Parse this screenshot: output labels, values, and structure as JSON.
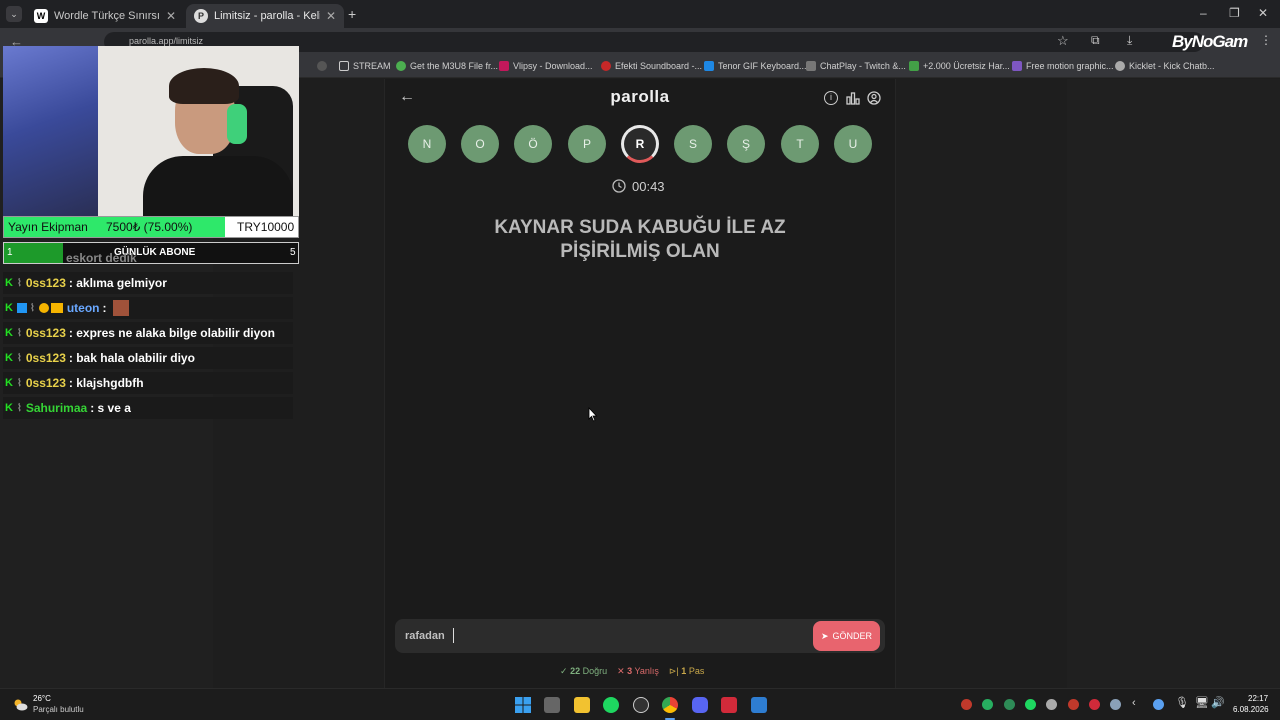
{
  "browser": {
    "tabs": [
      {
        "title": "Wordle Türkçe Sınırsız - Beklem",
        "icon": "W"
      },
      {
        "title": "Limitsiz - parolla - Kelime o",
        "icon": "P"
      }
    ],
    "url": "parolla.app/limitsiz",
    "bookmarks": [
      "STREAM",
      "Get the M3U8 File fr...",
      "Vlipsy - Download...",
      "Efekti Soundboard -...",
      "Tenor GIF Keyboard...",
      "ChatPlay - Twitch &...",
      "+2.000 Ücretsiz Har...",
      "Free motion graphic...",
      "Kicklet - Kick Chatb..."
    ],
    "watermark": "ByNoGam"
  },
  "game": {
    "title": "parolla",
    "letters": [
      "N",
      "O",
      "Ö",
      "P",
      "R",
      "S",
      "Ş",
      "T",
      "U"
    ],
    "current_letter": "R",
    "timer": "00:43",
    "question_line1": "KAYNAR SUDA KABUĞU İLE AZ",
    "question_line2": "PİŞİRİLMİŞ OLAN",
    "answer": "rafadan",
    "send_label": "GÖNDER",
    "stats": {
      "correct_count": "22",
      "correct_label": "Doğru",
      "wrong_count": "3",
      "wrong_label": "Yanlış",
      "pass_count": "1",
      "pass_label": "Pas"
    },
    "colors": {
      "letter": "#6d9a72",
      "accent": "#e8646e"
    }
  },
  "overlay": {
    "donation": {
      "label": "Yayın Ekipman",
      "progress": "7500₺ (75.00%)",
      "goal": "TRY10000",
      "percent": 75
    },
    "subs": {
      "start": "1",
      "label": "GÜNLÜK ABONE",
      "end": "5",
      "percent": 20
    },
    "chat_fragment": "eskort dedik",
    "chat": [
      {
        "user": "0ss123",
        "msg": ": aklıma gelmiyor",
        "color": "#e8d14a"
      },
      {
        "user": "uteon",
        "msg": ":",
        "color": "#6aa8ff"
      },
      {
        "user": "0ss123",
        "msg": ": expres ne alaka bilge olabilir diyon",
        "color": "#e8d14a"
      },
      {
        "user": "0ss123",
        "msg": ": bak hala olabilir diyo",
        "color": "#e8d14a"
      },
      {
        "user": "0ss123",
        "msg": ": klajshgdbfh",
        "color": "#e8d14a"
      },
      {
        "user": "Sahurimaa",
        "msg": ": s ve a",
        "color": "#35d435"
      }
    ]
  },
  "taskbar": {
    "temp": "26°C",
    "weather": "Parçalı bulutlu",
    "time": "22:17",
    "date": "6.08.2026"
  }
}
